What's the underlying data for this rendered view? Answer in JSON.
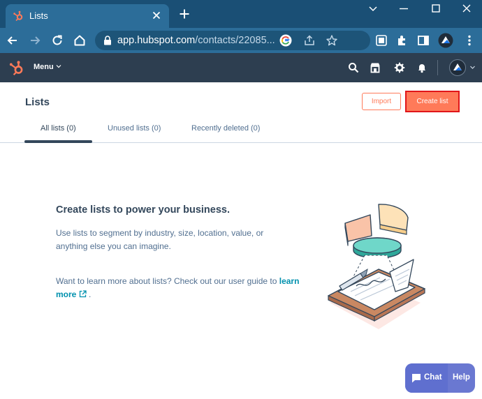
{
  "browser": {
    "tab_title": "Lists",
    "url_host": "app.hubspot.com",
    "url_path": "/contacts/22085..."
  },
  "nav": {
    "menu_label": "Menu"
  },
  "page": {
    "title": "Lists",
    "import_label": "Import",
    "create_label": "Create list",
    "tabs": [
      {
        "label": "All lists (0)",
        "active": true
      },
      {
        "label": "Unused lists (0)",
        "active": false
      },
      {
        "label": "Recently deleted (0)",
        "active": false
      }
    ]
  },
  "empty_state": {
    "heading": "Create lists to power your business.",
    "body": "Use lists to segment by industry, size, location, value, or anything else you can imagine.",
    "more_text": "Want to learn more about lists? Check out our user guide to",
    "link_label": "learn more",
    "period": "."
  },
  "chat": {
    "chat_label": "Chat",
    "help_label": "Help"
  },
  "colors": {
    "tabstrip": "#1a4f75",
    "toolbar": "#2c6d99",
    "hubspot_nav": "#2d3e50",
    "accent_orange": "#ff7a59",
    "highlight_red": "#e0161a",
    "text_dark": "#33475b",
    "link": "#0091ae",
    "chat": "#6a78d1"
  }
}
